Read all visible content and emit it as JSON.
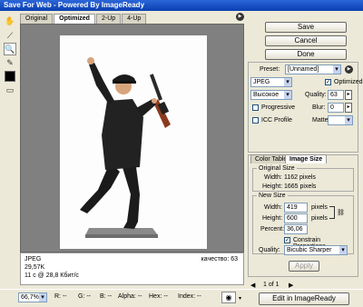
{
  "window": {
    "title": "Save For Web - Powered By ImageReady"
  },
  "tabs": [
    "Original",
    "Optimized",
    "2-Up",
    "4-Up"
  ],
  "active_tab": "Optimized",
  "buttons": {
    "save": "Save",
    "cancel": "Cancel",
    "done": "Done",
    "apply": "Apply",
    "edit": "Edit in ImageReady"
  },
  "preset": {
    "label": "Preset:",
    "value": "[Unnamed]"
  },
  "format": {
    "value": "JPEG",
    "optimized_label": "Optimized",
    "optimized_checked": true
  },
  "compression": {
    "value": "Высокое"
  },
  "quality": {
    "label": "Quality:",
    "value": "63"
  },
  "progressive": {
    "label": "Progressive",
    "checked": false
  },
  "blur": {
    "label": "Blur:",
    "value": "0"
  },
  "icc": {
    "label": "ICC Profile",
    "checked": false
  },
  "matte": {
    "label": "Matte:"
  },
  "panel_tabs": [
    "Color Table",
    "Image Size"
  ],
  "active_panel_tab": "Image Size",
  "original_size": {
    "title": "Original Size",
    "width_label": "Width:",
    "width": "1162 pixels",
    "height_label": "Height:",
    "height": "1665 pixels"
  },
  "new_size": {
    "title": "New Size",
    "width_label": "Width:",
    "width": "419",
    "width_unit": "pixels",
    "height_label": "Height:",
    "height": "600",
    "height_unit": "pixels",
    "percent_label": "Percent:",
    "percent": "36,06",
    "constrain_label": "Constrain Proportions",
    "constrain_checked": true,
    "quality_label": "Quality:",
    "quality_value": "Bicubic Sharper"
  },
  "info": {
    "format": "JPEG",
    "size": "29,57K",
    "time": "11 с @ 28,8 Кбит/с",
    "quality_text": "качество: 63"
  },
  "status": {
    "zoom": "66,7%",
    "r": "R: --",
    "g": "G: --",
    "b": "B: --",
    "alpha": "Alpha: --",
    "hex": "Hex: --",
    "index": "Index: --",
    "page": "1 of 1"
  }
}
